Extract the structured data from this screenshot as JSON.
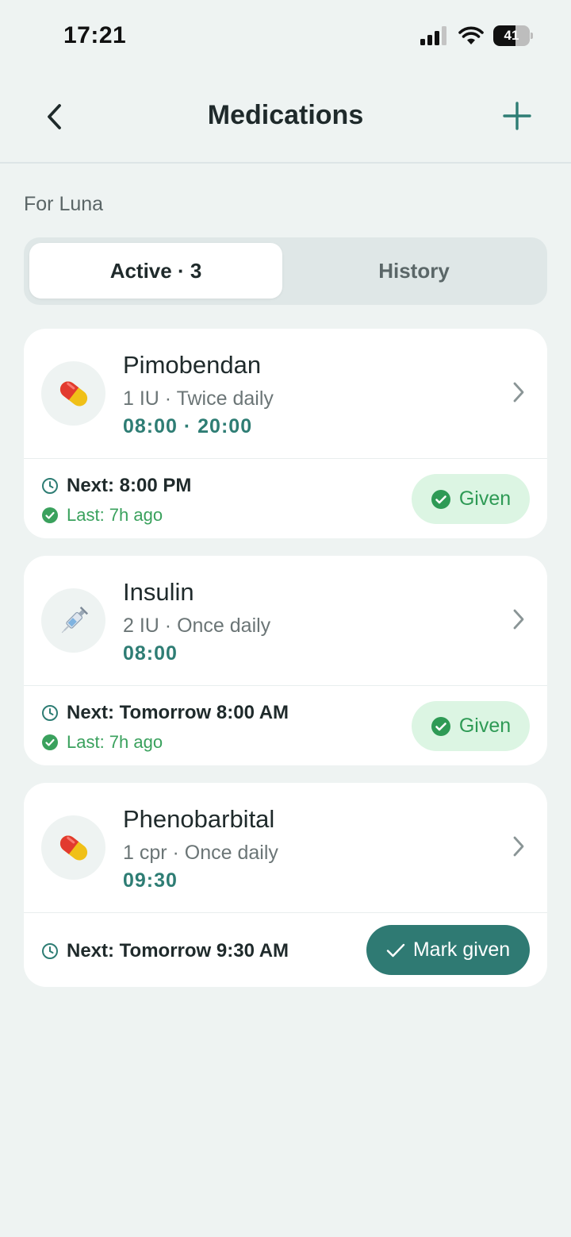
{
  "status_bar": {
    "time": "17:21",
    "battery_level": "41"
  },
  "nav": {
    "title": "Medications"
  },
  "subtitle": "For Luna",
  "tabs": {
    "active_label": "Active · 3",
    "inactive_label": "History"
  },
  "medications": [
    {
      "name": "Pimobendan",
      "dose": "1 IU · Twice daily",
      "times": "08:00 · 20:00",
      "icon": "pill-icon",
      "next": "Next: 8:00 PM",
      "last": "Last: 7h ago",
      "action": "Given"
    },
    {
      "name": "Insulin",
      "dose": "2 IU · Once daily",
      "times": "08:00",
      "icon": "syringe-icon",
      "next": "Next: Tomorrow 8:00 AM",
      "last": "Last: 7h ago",
      "action": "Given"
    },
    {
      "name": "Phenobarbital",
      "dose": "1 cpr · Once daily",
      "times": "09:30",
      "icon": "pill-icon",
      "next": "Next: Tomorrow 9:30 AM",
      "action": "Mark given"
    }
  ],
  "colors": {
    "accent": "#2e7d74",
    "given_bg": "#dcf5e3",
    "given_text": "#2e9a55",
    "primary_button": "#2f7a73"
  }
}
